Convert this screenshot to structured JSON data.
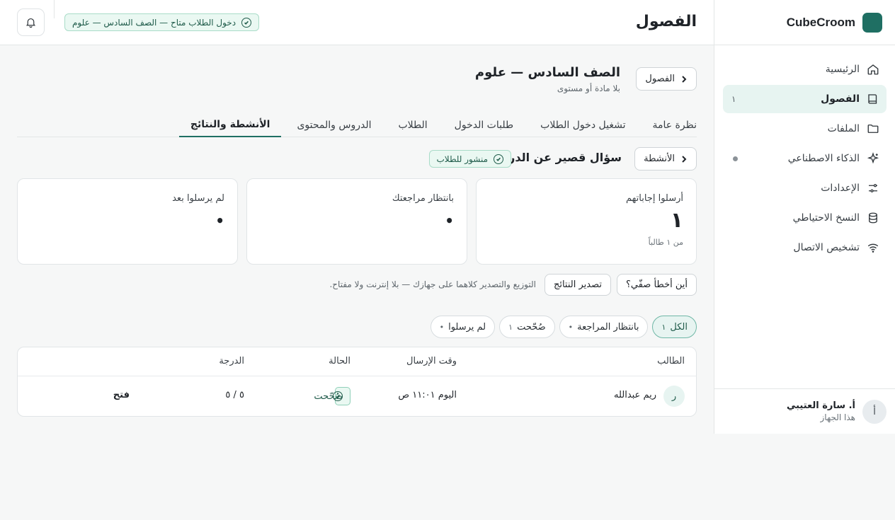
{
  "app": {
    "brand": "CubeCroom",
    "brand_color": "#1f6f63"
  },
  "sidebar": {
    "items": [
      {
        "label": "الرئيسية",
        "icon": "home-icon"
      },
      {
        "label": "الفصول",
        "icon": "book-icon",
        "count": "١",
        "active": true
      },
      {
        "label": "الملفات",
        "icon": "folder-icon"
      },
      {
        "label": "الذكاء الاصطناعي",
        "icon": "sparkle-icon",
        "dot": true
      },
      {
        "label": "الإعدادات",
        "icon": "sliders-icon"
      },
      {
        "label": "النسخ الاحتياطي",
        "icon": "database-icon"
      },
      {
        "label": "تشخيص الاتصال",
        "icon": "wifi-icon"
      }
    ],
    "user": {
      "initial": "أ",
      "name": "أ. سارة العتيبي",
      "sub": "هذا الجهاز"
    }
  },
  "header": {
    "title": "الفصول",
    "access_status": "دخول الطلاب متاح — الصف السادس — علوم"
  },
  "class": {
    "back_label": "الفصول",
    "title": "الصف السادس — علوم",
    "subtitle": "بلا مادة أو مستوى"
  },
  "tabs": [
    {
      "label": "نظرة عامة"
    },
    {
      "label": "تشغيل دخول الطلاب"
    },
    {
      "label": "طلبات الدخول"
    },
    {
      "label": "الطلاب"
    },
    {
      "label": "الدروس والمحتوى"
    },
    {
      "label": "الأنشطة والنتائج",
      "active": true
    }
  ],
  "activity": {
    "back_label": "الأنشطة",
    "title": "سؤال قصير عن الدرس",
    "status": "منشور للطلاب"
  },
  "stats": [
    {
      "label": "أرسلوا إجاباتهم",
      "value": "١",
      "sub": "من ١ طالباً"
    },
    {
      "label": "بانتظار مراجعتك",
      "value": "•"
    },
    {
      "label": "لم يرسلوا بعد",
      "value": "•"
    }
  ],
  "actions": {
    "mistakes_label": "أين أخطأ صفّي؟",
    "export_label": "تصدير النتائج",
    "note": "التوزيع والتصدير كلاهما على جهازك — بلا إنترنت ولا مفتاح."
  },
  "filters": [
    {
      "label": "الكل",
      "count": "١",
      "active": true
    },
    {
      "label": "بانتظار المراجعة",
      "count": "•"
    },
    {
      "label": "صُحّحت",
      "count": "١"
    },
    {
      "label": "لم يرسلوا",
      "count": "•"
    }
  ],
  "table": {
    "columns": {
      "student": "الطالب",
      "time": "وقت الإرسال",
      "status": "الحالة",
      "grade": "الدرجة"
    },
    "rows": [
      {
        "initial": "ر",
        "student": "ريم عبدالله",
        "time": "اليوم ١١:٠١ ص",
        "status": "صُحّحت",
        "grade": "٥ / ٥",
        "action": "فتح"
      }
    ]
  }
}
